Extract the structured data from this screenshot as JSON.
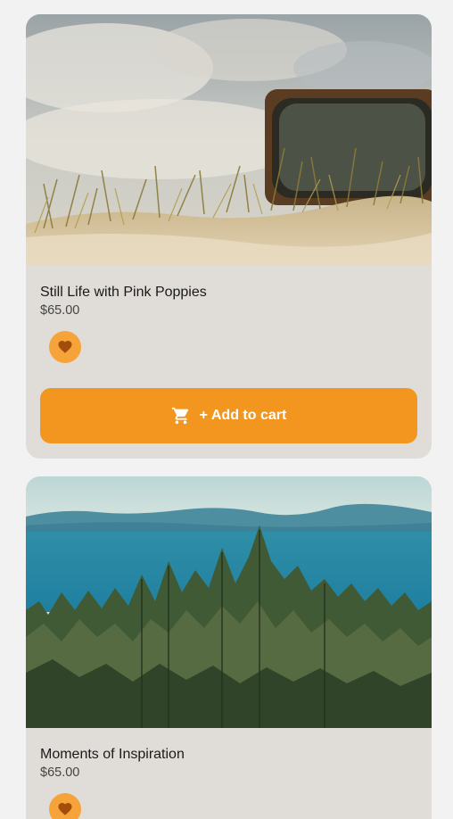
{
  "products": [
    {
      "title": "Still Life with Pink Poppies",
      "price": "$65.00",
      "add_to_cart_label": "+ Add to cart"
    },
    {
      "title": "Moments of Inspiration",
      "price": "$65.00"
    }
  ],
  "icons": {
    "favorite": "heart-icon",
    "cart": "cart-icon"
  },
  "colors": {
    "accent": "#f2961f",
    "favorite_bg": "#f6a33a",
    "favorite_fg": "#a34d0c",
    "card_bg": "#e0ddd8"
  }
}
